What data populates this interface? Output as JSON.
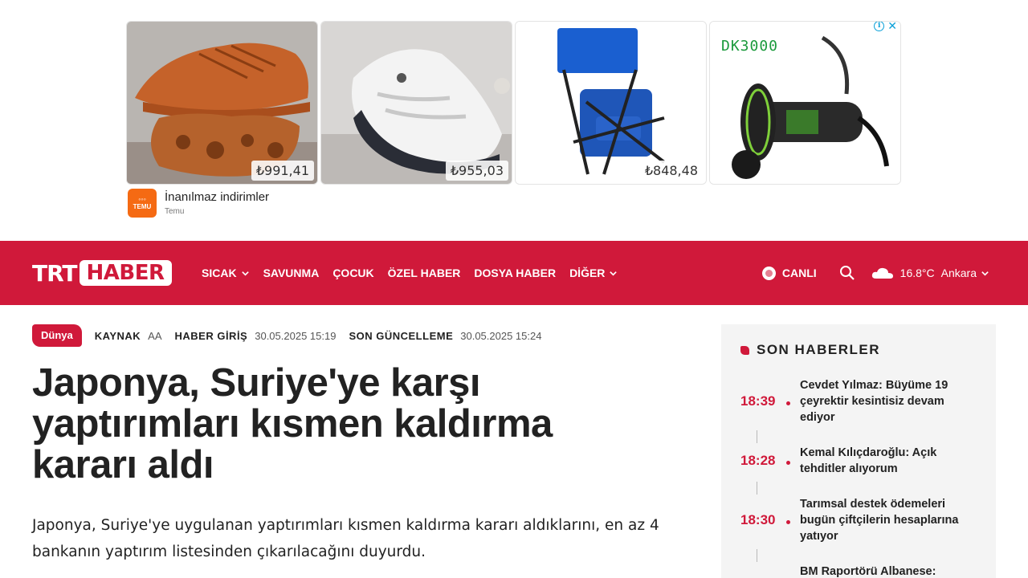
{
  "ad": {
    "products": [
      {
        "price": "₺991,41",
        "desc": "orange-sneaker"
      },
      {
        "price": "₺955,03",
        "desc": "white-sneaker"
      },
      {
        "price": "₺848,48",
        "desc": "blue-folding-chair"
      },
      {
        "price": "",
        "desc": "fishing-reel",
        "label": "DK3000"
      }
    ],
    "title": "İnanılmaz indirimler",
    "brand": "Temu",
    "logo_text": "TEMU",
    "info_icon": "info-icon",
    "close_icon": "close-icon"
  },
  "header": {
    "logo_left": "TRT",
    "logo_right": "HABER",
    "nav": [
      {
        "label": "SICAK",
        "dropdown": true
      },
      {
        "label": "SAVUNMA",
        "dropdown": false
      },
      {
        "label": "ÇOCUK",
        "dropdown": false
      },
      {
        "label": "ÖZEL HABER",
        "dropdown": false
      },
      {
        "label": "DOSYA HABER",
        "dropdown": false
      },
      {
        "label": "DİĞER",
        "dropdown": true
      }
    ],
    "live_label": "CANLI",
    "temperature": "16.8°C",
    "city": "Ankara",
    "brand_color": "#d0193a"
  },
  "article": {
    "category": "Dünya",
    "source_label": "KAYNAK",
    "source_value": "AA",
    "published_label": "HABER GİRİŞ",
    "published_value": "30.05.2025 15:19",
    "updated_label": "SON GÜNCELLEME",
    "updated_value": "30.05.2025 15:24",
    "headline": "Japonya, Suriye'ye karşı yaptırımları kısmen kaldırma kararı aldı",
    "lead": "Japonya, Suriye'ye uygulanan yaptırımları kısmen kaldırma kararı aldıklarını, en az 4 bankanın yaptırım listesinden çıkarılacağını duyurdu."
  },
  "sidebar": {
    "title": "SON HABERLER",
    "items": [
      {
        "time": "18:39",
        "text": "Cevdet Yılmaz: Büyüme 19 çeyrektir kesintisiz devam ediyor"
      },
      {
        "time": "18:28",
        "text": "Kemal Kılıçdaroğlu: Açık tehditler alıyorum"
      },
      {
        "time": "18:30",
        "text": "Tarımsal destek ödemeleri bugün çiftçilerin hesaplarına yatıyor"
      },
      {
        "time": "",
        "text": "BM Raportörü Albanese:"
      }
    ]
  }
}
